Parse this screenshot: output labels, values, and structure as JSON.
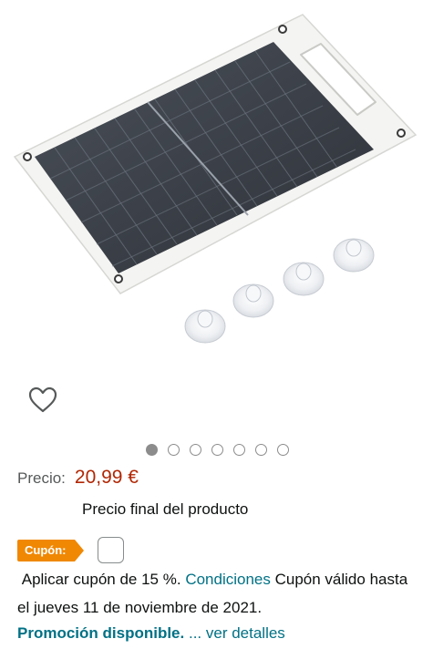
{
  "product": {
    "image_icon": "solar-panel-image"
  },
  "wishlist": {
    "icon": "heart-outline-icon"
  },
  "carousel": {
    "count": 7,
    "active_index": 0
  },
  "price": {
    "label": "Precio:",
    "value": "20,99 €",
    "final_text": "Precio final del producto"
  },
  "coupon": {
    "badge": "Cupón:",
    "checked": false,
    "text_before": "Aplicar cupón de 15 %.",
    "conditions_link": "Condiciones",
    "text_after": "Cupón válido hasta el jueves 11 de noviembre de 2021."
  },
  "promotion": {
    "label": "Promoción disponible.",
    "details_link": "... ver detalles"
  },
  "colors": {
    "price": "#b12704",
    "link": "#007185",
    "coupon_badge": "#f08804"
  }
}
